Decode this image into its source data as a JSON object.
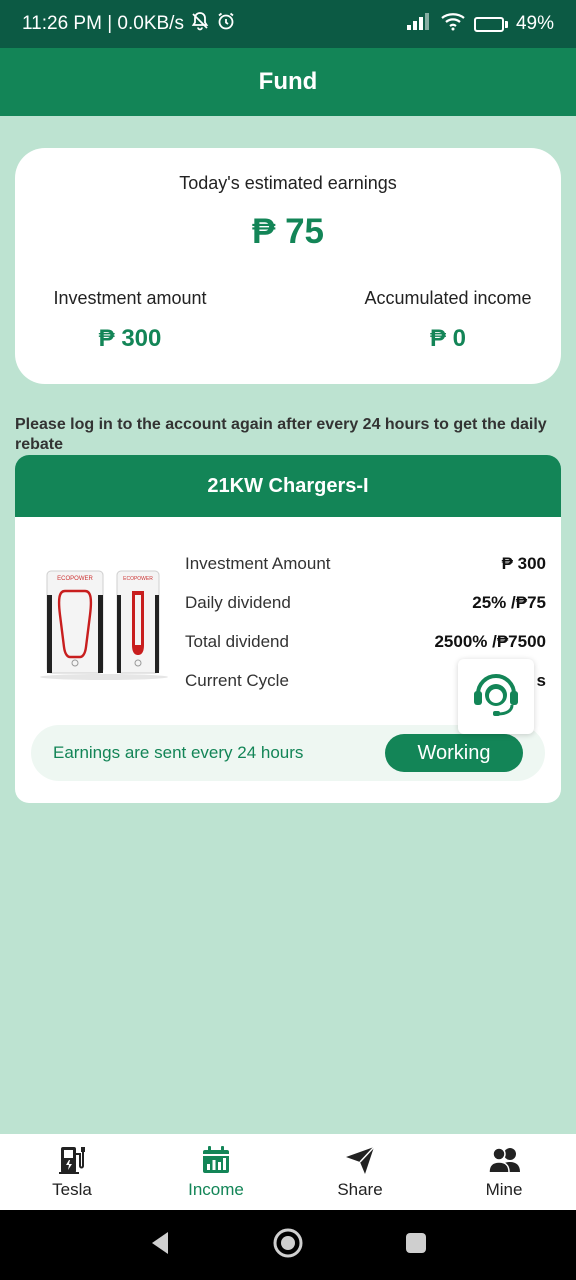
{
  "status_bar": {
    "time_speed": "11:26 PM | 0.0KB/s",
    "battery": "49%",
    "battery_level": 0.49,
    "icons": [
      "bell-off-icon",
      "alarm-icon",
      "signal-icon",
      "wifi-icon",
      "battery-icon"
    ]
  },
  "header": {
    "title": "Fund"
  },
  "summary": {
    "today_label": "Today's estimated earnings",
    "today_value": "₱ 75",
    "investment_label": "Investment amount",
    "investment_value": "₱ 300",
    "accumulated_label": "Accumulated income",
    "accumulated_value": "₱ 0"
  },
  "notice": "Please log in to the account again after every 24 hours to get the daily rebate",
  "product": {
    "title": "21KW Chargers-I",
    "image_label": "ECOPOWER",
    "rows": [
      {
        "label": "Investment Amount",
        "value": "₱ 300"
      },
      {
        "label": "Daily dividend",
        "value": "25% /₱75"
      },
      {
        "label": "Total dividend",
        "value": "2500% /₱7500"
      },
      {
        "label": "Current Cycle",
        "value": "s"
      }
    ],
    "earn_text": "Earnings are sent every 24 hours",
    "status_button": "Working"
  },
  "bottom_nav": [
    {
      "label": "Tesla",
      "icon": "charger-icon",
      "active": false
    },
    {
      "label": "Income",
      "icon": "calendar-chart-icon",
      "active": true
    },
    {
      "label": "Share",
      "icon": "send-icon",
      "active": false
    },
    {
      "label": "Mine",
      "icon": "users-icon",
      "active": false
    }
  ],
  "colors": {
    "primary": "#138557",
    "background": "#bde3d1",
    "status_bar": "#0c5a44"
  }
}
